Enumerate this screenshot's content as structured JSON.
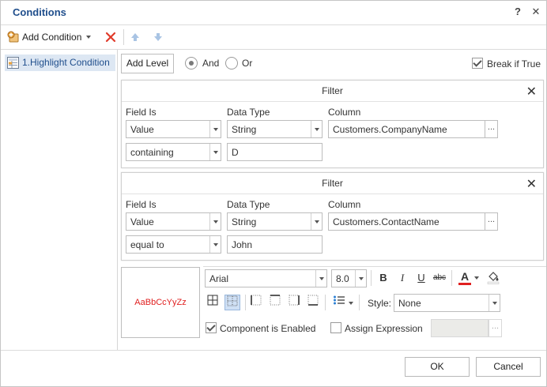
{
  "window": {
    "title": "Conditions",
    "help_symbol": "?",
    "close_symbol": "✕"
  },
  "toolbar": {
    "add_condition_label": "Add Condition",
    "icons": [
      "add-condition-icon",
      "dropdown-arrow-icon",
      "remove-icon",
      "move-up-icon",
      "move-down-icon"
    ]
  },
  "conditions": {
    "items": [
      {
        "label": "1.Highlight Condition"
      }
    ]
  },
  "level": {
    "add_level_label": "Add Level",
    "and_label": "And",
    "or_label": "Or",
    "selected": "And",
    "break_label": "Break if True",
    "break_checked": true
  },
  "filters": [
    {
      "title": "Filter",
      "field_is_label": "Field Is",
      "data_type_label": "Data Type",
      "column_label": "Column",
      "field_is": "Value",
      "data_type": "String",
      "column": "Customers.CompanyName",
      "operator": "containing",
      "value": "D",
      "ellipsis": "..."
    },
    {
      "title": "Filter",
      "field_is_label": "Field Is",
      "data_type_label": "Data Type",
      "column_label": "Column",
      "field_is": "Value",
      "data_type": "String",
      "column": "Customers.ContactName",
      "operator": "equal to",
      "value": "John",
      "ellipsis": "..."
    }
  ],
  "style_panel": {
    "preview_text": "AaBbCcYyZz",
    "font_name": "Arial",
    "font_size": "8.0",
    "bold_label": "B",
    "italic_label": "I",
    "underline_label": "U",
    "strike_label": "abc",
    "font_color_label": "A",
    "style_label": "Style:",
    "style_value": "None",
    "component_enabled_label": "Component is Enabled",
    "component_enabled_checked": true,
    "assign_expression_label": "Assign Expression",
    "assign_expression_checked": false,
    "ellipsis": "..."
  },
  "footer": {
    "ok_label": "OK",
    "cancel_label": "Cancel"
  },
  "colors": {
    "accent": "#1f4e8c",
    "selection": "#dde7f3",
    "preview_text": "#e02020",
    "font_color_bar": "#e02020",
    "remove_icon": "#e03a2a"
  }
}
